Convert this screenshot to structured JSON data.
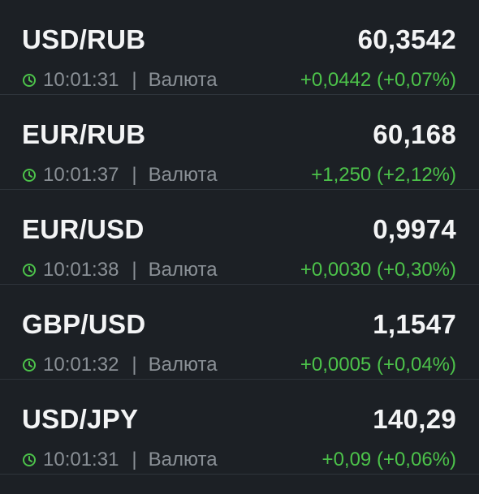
{
  "colors": {
    "background": "#1c2025",
    "divider": "#2e343b",
    "primary_text": "#f3f4f5",
    "secondary_text": "#8a9096",
    "positive": "#4cc24a",
    "clock_icon": "#4cc24a"
  },
  "quotes": [
    {
      "pair": "USD/RUB",
      "price": "60,3542",
      "time": "10:01:31",
      "separator": "|",
      "type": "Валюта",
      "change": "+0,0442 (+0,07%)",
      "icon": "clock-icon"
    },
    {
      "pair": "EUR/RUB",
      "price": "60,168",
      "time": "10:01:37",
      "separator": "|",
      "type": "Валюта",
      "change": "+1,250 (+2,12%)",
      "icon": "clock-icon"
    },
    {
      "pair": "EUR/USD",
      "price": "0,9974",
      "time": "10:01:38",
      "separator": "|",
      "type": "Валюта",
      "change": "+0,0030 (+0,30%)",
      "icon": "clock-icon"
    },
    {
      "pair": "GBP/USD",
      "price": "1,1547",
      "time": "10:01:32",
      "separator": "|",
      "type": "Валюта",
      "change": "+0,0005 (+0,04%)",
      "icon": "clock-icon"
    },
    {
      "pair": "USD/JPY",
      "price": "140,29",
      "time": "10:01:31",
      "separator": "|",
      "type": "Валюта",
      "change": "+0,09 (+0,06%)",
      "icon": "clock-icon"
    }
  ]
}
